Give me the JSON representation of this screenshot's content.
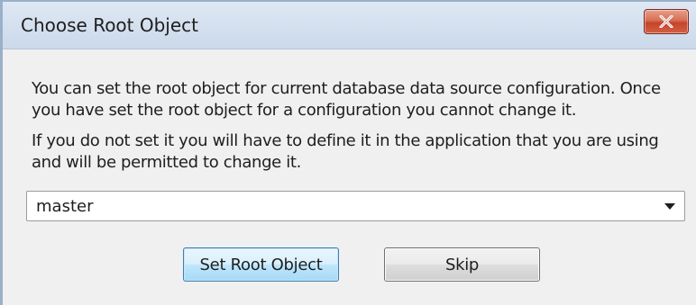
{
  "window": {
    "title": "Choose Root Object",
    "close_icon": "close-icon"
  },
  "message": {
    "line1": "You can set the root object for current database data source configuration. Once you have set the root object for a configuration you cannot change it.",
    "line2": "If you do not set it you will have to define it in the application that you are using and will be permitted to change it."
  },
  "root_select": {
    "selected": "master",
    "arrow_icon": "chevron-down-icon"
  },
  "buttons": {
    "set_root": "Set Root Object",
    "skip": "Skip"
  },
  "colors": {
    "close_button": "#c4452a",
    "titlebar": "#cbd9ea",
    "primary_button_border": "#3c7fb1"
  }
}
